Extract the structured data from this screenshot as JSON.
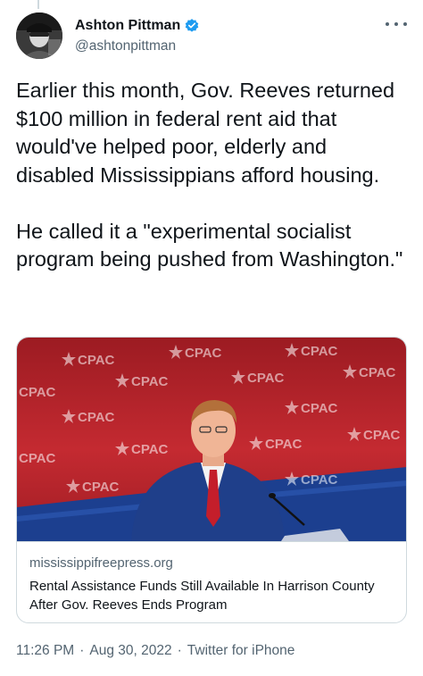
{
  "author": {
    "name": "Ashton Pittman",
    "handle": "@ashtonpittman",
    "verified": true,
    "avatar_icon": "profile-photo"
  },
  "tweet": {
    "paragraphs": [
      "Earlier this month, Gov. Reeves returned $100 million in federal rent aid that would've helped poor, elderly and disabled Mississippians afford housing.",
      "He called it a \"experimental socialist program being pushed from Washington.\""
    ]
  },
  "card": {
    "image_backdrop_text": "CPAC",
    "domain": "mississippifreepress.org",
    "title": "Rental Assistance Funds Still Available In Harrison County After Gov. Reeves Ends Program"
  },
  "meta": {
    "time": "11:26 PM",
    "date": "Aug 30, 2022",
    "source": "Twitter for iPhone"
  },
  "colors": {
    "verified": "#1d9bf0",
    "secondary_text": "#536471",
    "border": "#cfd9de",
    "backdrop_red": "#b8232b",
    "backdrop_blue": "#1c3f8f"
  }
}
